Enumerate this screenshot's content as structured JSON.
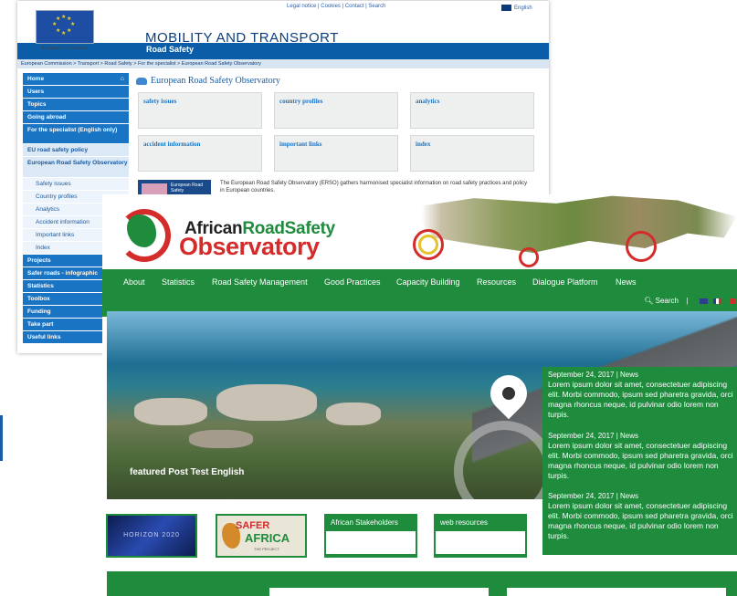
{
  "eu": {
    "util_links": "Legal notice | Cookies | Contact | Search",
    "lang": "English",
    "logo_text": "European Commission",
    "title": "MOBILITY AND TRANSPORT",
    "subtitle": "Road Safety",
    "breadcrumb": "European Commission > Transport > Road Safety > For the specialist > European Road Safety Observatory",
    "sidebar": [
      {
        "label": "Home",
        "kind": "top"
      },
      {
        "label": "Users",
        "kind": "top"
      },
      {
        "label": "Topics",
        "kind": "top"
      },
      {
        "label": "Going abroad",
        "kind": "top"
      },
      {
        "label": "For the specialist (English only)",
        "kind": "top-tall"
      },
      {
        "label": "EU road safety policy",
        "kind": "sub"
      },
      {
        "label": "European Road Safety Observatory",
        "kind": "sub-tall"
      },
      {
        "label": "Safety issues",
        "kind": "sub2"
      },
      {
        "label": "Country profiles",
        "kind": "sub2"
      },
      {
        "label": "Analytics",
        "kind": "sub2"
      },
      {
        "label": "Accident information",
        "kind": "sub2"
      },
      {
        "label": "Important links",
        "kind": "sub2"
      },
      {
        "label": "Index",
        "kind": "sub2"
      },
      {
        "label": "Projects",
        "kind": "top"
      },
      {
        "label": "Safer roads - infographic",
        "kind": "top"
      },
      {
        "label": "Statistics",
        "kind": "top"
      },
      {
        "label": "Toolbox",
        "kind": "top"
      },
      {
        "label": "Funding",
        "kind": "top"
      },
      {
        "label": "Take part",
        "kind": "top"
      },
      {
        "label": "Useful links",
        "kind": "top"
      }
    ],
    "main_title": "European Road Safety Observatory",
    "cells": [
      "safety issues",
      "country profiles",
      "analytics",
      "accident information",
      "important links",
      "index"
    ],
    "erso_logo": "European Road Safety",
    "description": "The European Road Safety Observatory (ERSO) gathers harmonised specialist information on road safety practices and policy in European countries."
  },
  "ar": {
    "brand_line1_a": "African",
    "brand_line1_b": "RoadSafety",
    "brand_line2": "Observatory",
    "nav": [
      "About",
      "Statistics",
      "Road Safety Management",
      "Good Practices",
      "Capacity Building",
      "Resources",
      "Dialogue Platform",
      "News"
    ],
    "search_label": "Search",
    "hero_caption": "featured Post Test English",
    "news": [
      {
        "date": "September 24, 2017 | News",
        "text": "Lorem ipsum dolor sit amet, consectetuer adipiscing elit. Morbi commodo, ipsum sed pharetra gravida, orci magna rhoncus neque, id pulvinar odio lorem non turpis."
      },
      {
        "date": "September 24, 2017 | News",
        "text": "Lorem ipsum dolor sit amet, consectetuer adipiscing elit. Morbi commodo, ipsum sed pharetra gravida, orci magna rhoncus neque, id pulvinar odio lorem non turpis."
      },
      {
        "date": "September 24, 2017 | News",
        "text": "Lorem ipsum dolor sit amet, consectetuer adipiscing elit. Morbi commodo, ipsum sed pharetra gravida, orci magna rhoncus neque, id pulvinar odio lorem non turpis."
      }
    ],
    "box_horizon": "HORIZON 2020",
    "box_safer_1": "SAFER",
    "box_safer_2": "AFRICA",
    "box_safer_3": "THE PROJECT",
    "box_stakeholders": "African Stakeholders",
    "box_web": "web resources"
  },
  "colors": {
    "eu_blue": "#0b5da8",
    "ar_green": "#1e8b3d",
    "ar_red": "#d42b2b"
  }
}
